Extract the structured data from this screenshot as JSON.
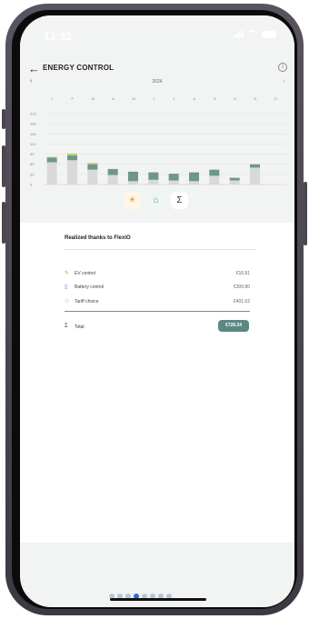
{
  "status": {
    "time": "13:32"
  },
  "header": {
    "title": "ENERGY CONTROL"
  },
  "nav": {
    "year": "2024",
    "prev": "‹",
    "next": "›"
  },
  "chart_data": {
    "type": "bar",
    "categories": [
      "J",
      "F",
      "M",
      "A",
      "M",
      "J",
      "J",
      "A",
      "S",
      "O",
      "N",
      "D"
    ],
    "yticks": [
      210,
      180,
      150,
      120,
      90,
      60,
      30,
      0
    ],
    "series": [
      {
        "values": [
          66,
          72,
          44,
          28,
          10,
          14,
          12,
          10,
          26,
          12,
          50,
          0
        ]
      },
      {
        "values": [
          14,
          14,
          16,
          18,
          28,
          22,
          20,
          26,
          18,
          8,
          10,
          0
        ]
      },
      {
        "values": [
          2,
          6,
          4,
          0,
          0,
          0,
          0,
          0,
          0,
          0,
          0,
          0
        ]
      }
    ],
    "ylim": [
      0,
      210
    ],
    "colors": {
      "consumption": "#d9d9d9",
      "battery": "#6f958f",
      "ev": "#b7d46f"
    }
  },
  "modes": [
    {
      "name": "sun-mode",
      "icon": "☀"
    },
    {
      "name": "home-mode",
      "icon": "⌂"
    },
    {
      "name": "sum-mode",
      "icon": "Σ"
    }
  ],
  "savings": {
    "title": "Realized thanks to FlexiO",
    "rows": [
      {
        "label": "EV control",
        "amount": "€16.81",
        "icon": "✎"
      },
      {
        "label": "Battery control",
        "amount": "€309.80",
        "icon": "▯"
      },
      {
        "label": "Tariff choice",
        "amount": "€401.62",
        "icon": "⚇"
      }
    ],
    "total_label": "Total",
    "total_icon": "Σ",
    "total_amount": "€728.24"
  },
  "pager": {
    "count": 8,
    "active": 3
  }
}
